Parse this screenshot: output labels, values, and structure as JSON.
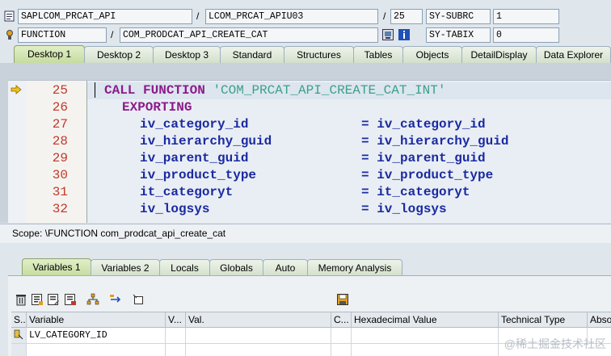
{
  "header": {
    "program": "SAPLCOM_PRCAT_API",
    "include": "LCOM_PRCAT_APIU03",
    "line": "25",
    "subrc_label": "SY-SUBRC",
    "subrc_value": "1",
    "event_type": "FUNCTION",
    "event_name": "COM_PRODCAT_API_CREATE_CAT",
    "tabix_label": "SY-TABIX",
    "tabix_value": "0",
    "slash": "/"
  },
  "tabs": [
    "Desktop 1",
    "Desktop 2",
    "Desktop 3",
    "Standard",
    "Structures",
    "Tables",
    "Objects",
    "DetailDisplay",
    "Data Explorer"
  ],
  "active_tab": "Desktop 1",
  "code_lines": [
    {
      "no": "25",
      "text": "CALL FUNCTION 'COM_PRCAT_API_CREATE_CAT_INT'"
    },
    {
      "no": "26",
      "text": "EXPORTING"
    },
    {
      "no": "27",
      "param": "iv_category_id",
      "value": "= iv_category_id"
    },
    {
      "no": "28",
      "param": "iv_hierarchy_guid",
      "value": "= iv_hierarchy_guid"
    },
    {
      "no": "29",
      "param": "iv_parent_guid",
      "value": "= iv_parent_guid"
    },
    {
      "no": "30",
      "param": "iv_product_type",
      "value": "= iv_product_type"
    },
    {
      "no": "31",
      "param": "it_categoryt",
      "value": "= it_categoryt"
    },
    {
      "no": "32",
      "param": "iv_logsys",
      "value": "= iv_logsys"
    }
  ],
  "code_keywords": {
    "call": "CALL FUNCTION",
    "fname": "'COM_PRCAT_API_CREATE_CAT_INT'"
  },
  "scope": "Scope: \\FUNCTION com_prodcat_api_create_cat",
  "subtabs": [
    "Variables 1",
    "Variables 2",
    "Locals",
    "Globals",
    "Auto",
    "Memory Analysis"
  ],
  "active_subtab": "Variables 1",
  "grid": {
    "columns": [
      "S...",
      "Variable",
      "V...",
      "Val.",
      "C...",
      "Hexadecimal Value",
      "Technical Type",
      "Abso"
    ],
    "rows": [
      {
        "variable": "LV_CATEGORY_ID"
      }
    ]
  },
  "watermark": "@稀土掘金技术社区",
  "colors": {
    "keyword": "#8b1c8b",
    "variable": "#1a2aa0",
    "string": "#3aa08a",
    "line_number": "#c0392b",
    "active_tab": "#c5dca0"
  }
}
